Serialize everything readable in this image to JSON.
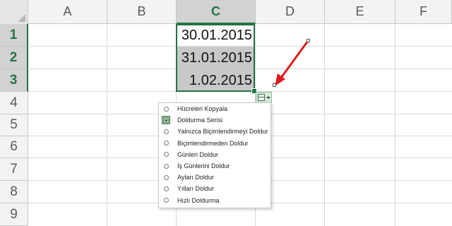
{
  "columns": [
    "A",
    "B",
    "C",
    "D",
    "E",
    "F"
  ],
  "selected_column": "C",
  "rows": [
    "1",
    "2",
    "3",
    "4",
    "5",
    "6",
    "7",
    "8",
    "9"
  ],
  "selected_rows": [
    "1",
    "2",
    "3"
  ],
  "cells": [
    {
      "ref": "C1",
      "value": "30.01.2015"
    },
    {
      "ref": "C2",
      "value": "31.01.2015"
    },
    {
      "ref": "C3",
      "value": "1.02.2015"
    }
  ],
  "autofill_menu": {
    "items": [
      {
        "label": "Hücreleri Kopyala",
        "selected": false
      },
      {
        "label": "Doldurma Serisi",
        "selected": true
      },
      {
        "label": "Yalnızca Biçimlendirmeyi Doldur",
        "selected": false
      },
      {
        "label": "Biçimlendirmeden Doldur",
        "selected": false
      },
      {
        "label": "Günleri Doldur",
        "selected": false
      },
      {
        "label": "İş Günlerini Doldur",
        "selected": false
      },
      {
        "label": "Ayları Doldur",
        "selected": false
      },
      {
        "label": "Yılları Doldur",
        "selected": false
      },
      {
        "label": "Hızlı Doldurma",
        "selected": false
      }
    ]
  },
  "colors": {
    "accent": "#217346",
    "selection_fill": "#c8c8c8",
    "arrow": "#e01b1b"
  },
  "icons": {
    "autofill_options": "autofill-options-icon",
    "annotation": "red-arrow"
  }
}
